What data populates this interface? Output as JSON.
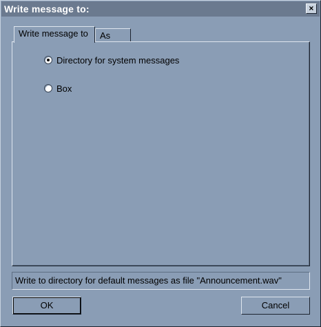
{
  "window": {
    "title": "Write message to:",
    "close_glyph": "×"
  },
  "tabs": [
    {
      "label": "Write message to",
      "active": true
    },
    {
      "label": "As",
      "active": false
    }
  ],
  "options": [
    {
      "label": "Directory for system messages",
      "checked": true
    },
    {
      "label": "Box",
      "checked": false
    }
  ],
  "status": "Write to directory for default messages as file \"Announcement.wav\"",
  "buttons": {
    "ok": "OK",
    "cancel": "Cancel"
  },
  "colors": {
    "background": "#8a9db5",
    "titlebar": "#6b7a8f"
  }
}
